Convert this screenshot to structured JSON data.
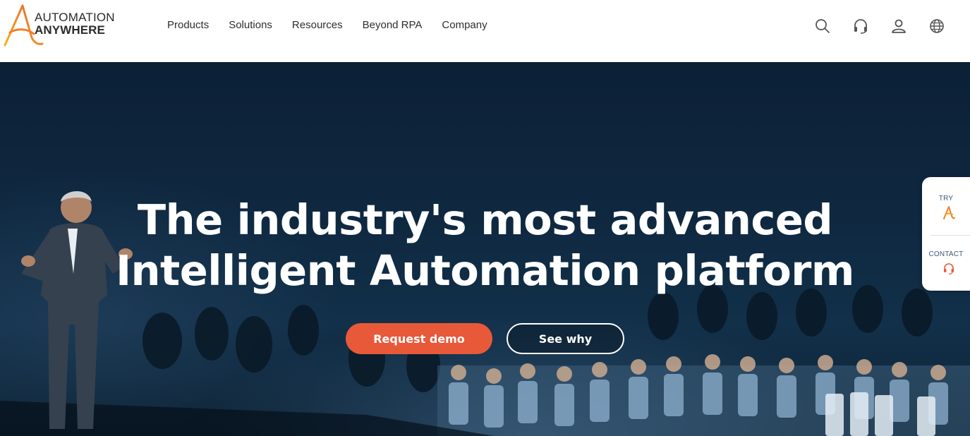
{
  "brand": {
    "line1": "AUTOMATION",
    "line2": "ANYWHERE",
    "accent": "#e8593a",
    "accent_gold": "#f3a21b"
  },
  "nav": {
    "items": [
      {
        "label": "Products"
      },
      {
        "label": "Solutions"
      },
      {
        "label": "Resources"
      },
      {
        "label": "Beyond RPA"
      },
      {
        "label": "Company"
      }
    ]
  },
  "utility_icons": [
    "search-icon",
    "headset-icon",
    "user-icon",
    "globe-icon"
  ],
  "hero": {
    "headline_line1": "The industry's most advanced",
    "headline_line2": "Intelligent Automation platform",
    "primary_button": "Request demo",
    "secondary_button": "See why"
  },
  "side_widget": {
    "try_label": "TRY",
    "contact_label": "CONTACT"
  }
}
